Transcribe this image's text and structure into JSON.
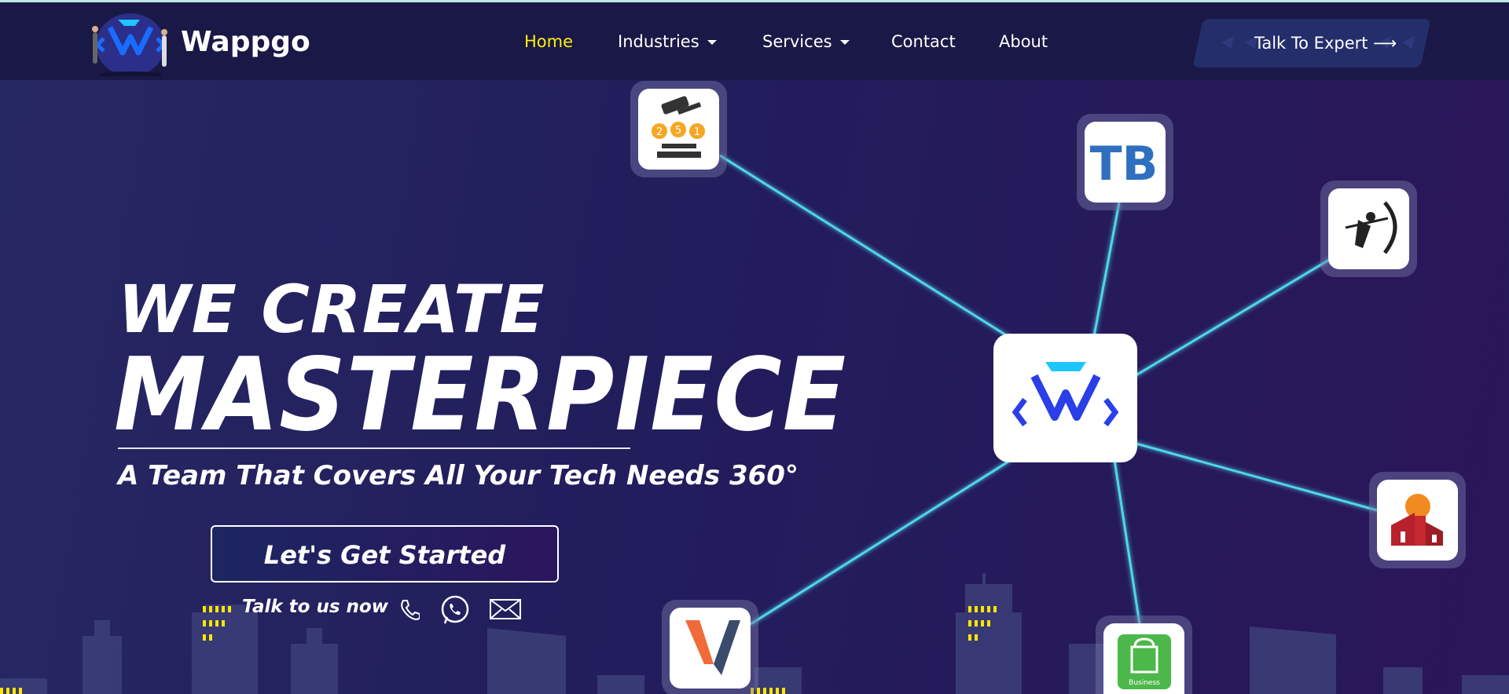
{
  "brand": {
    "name": "Wappgo",
    "logo_icon": "wappgo-logo"
  },
  "nav": {
    "items": [
      {
        "label": "Home",
        "active": true,
        "dropdown": false
      },
      {
        "label": "Industries",
        "active": false,
        "dropdown": true
      },
      {
        "label": "Services",
        "active": false,
        "dropdown": true
      },
      {
        "label": "Contact",
        "active": false,
        "dropdown": false
      },
      {
        "label": "About",
        "active": false,
        "dropdown": false
      }
    ],
    "cta_label": "Talk To Expert ⟶"
  },
  "hero": {
    "line1": "WE CREATE",
    "line2": "MASTERPIECE",
    "subtitle": "A Team That Covers All Your Tech Needs 360°",
    "button_label": "Let's Get Started",
    "talk_label": "Talk to us now"
  },
  "contact_icons": [
    "phone-icon",
    "whatsapp-icon",
    "mail-icon"
  ],
  "network": {
    "hub_icon": "wappgo-logo",
    "nodes": [
      {
        "name": "auction-app-icon"
      },
      {
        "name": "tb-app-icon"
      },
      {
        "name": "archer-app-icon"
      },
      {
        "name": "real-estate-app-icon"
      },
      {
        "name": "business-bag-app-icon",
        "label": "Business"
      },
      {
        "name": "v-app-icon"
      }
    ]
  },
  "colors": {
    "bg_start": "#262863",
    "bg_end": "#2a1659",
    "header_bg": "#1a1846",
    "active_nav": "#ffef0a",
    "link_line": "#4fd6e8",
    "window_lights": "#ffe600"
  }
}
